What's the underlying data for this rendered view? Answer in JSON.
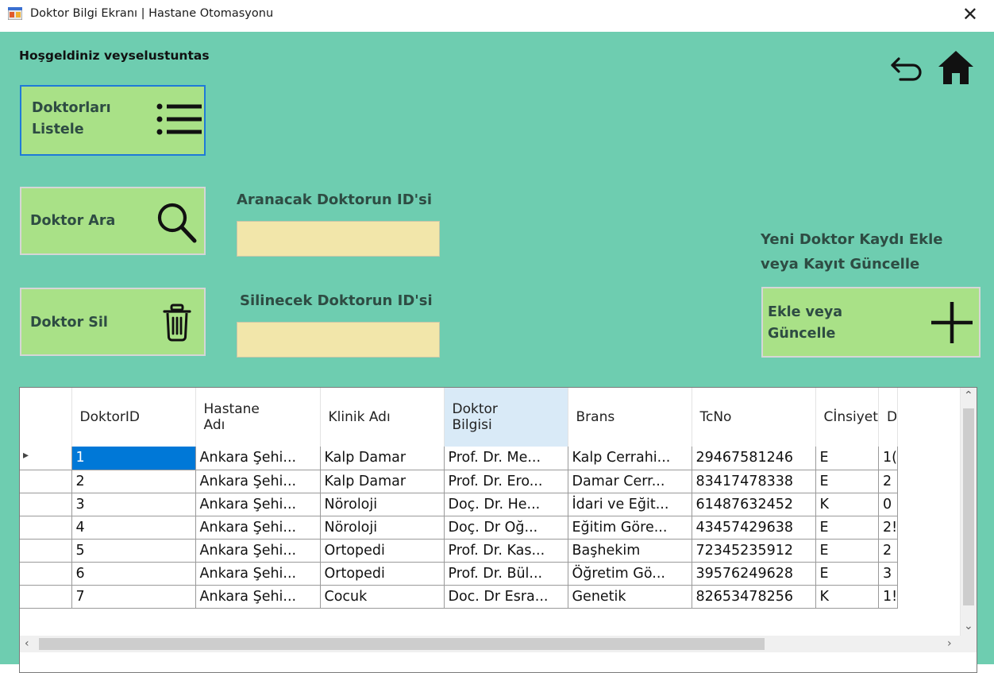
{
  "window": {
    "title": "Doktor Bilgi Ekranı | Hastane Otomasyonu"
  },
  "header": {
    "welcome": "Hoşgeldiniz veyselustuntas"
  },
  "buttons": {
    "list_line1": "Doktorları",
    "list_line2": "Listele",
    "search": "Doktor Ara",
    "delete": "Doktor Sil",
    "add_line1": "Ekle veya",
    "add_line2": "Güncelle"
  },
  "search_field": {
    "label": "Aranacak Doktorun ID'si",
    "value": ""
  },
  "delete_field": {
    "label": "Silinecek Doktorun ID'si",
    "value": ""
  },
  "add_section": {
    "line1": "Yeni Doktor Kaydı Ekle",
    "line2": "veya Kayıt Güncelle"
  },
  "table": {
    "headers": [
      {
        "l1": "DoktorID",
        "l2": ""
      },
      {
        "l1": "Hastane",
        "l2": "Adı"
      },
      {
        "l1": "Klinik Adı",
        "l2": ""
      },
      {
        "l1": "Doktor",
        "l2": "Bilgisi"
      },
      {
        "l1": "Brans",
        "l2": ""
      },
      {
        "l1": "TcNo",
        "l2": ""
      },
      {
        "l1": "Cİnsiyet",
        "l2": ""
      },
      {
        "l1": "D",
        "l2": ""
      }
    ],
    "rows": [
      [
        "1",
        "Ankara Şehi...",
        "Kalp Damar",
        "Prof. Dr. Me...",
        "Kalp Cerrahi...",
        "29467581246",
        "E",
        "1("
      ],
      [
        "2",
        "Ankara Şehi...",
        "Kalp Damar",
        "Prof. Dr. Ero...",
        "Damar Cerr...",
        "83417478338",
        "E",
        "2"
      ],
      [
        "3",
        "Ankara Şehi...",
        "Nöroloji",
        "Doç. Dr. He...",
        "İdari ve Eğit...",
        "61487632452",
        "K",
        "0"
      ],
      [
        "4",
        "Ankara Şehi...",
        "Nöroloji",
        "Doç. Dr Oğ...",
        "Eğitim Göre...",
        "43457429638",
        "E",
        "2!"
      ],
      [
        "5",
        "Ankara Şehi...",
        "Ortopedi",
        "Prof. Dr. Kas...",
        "Başhekim",
        "72345235912",
        "E",
        "2"
      ],
      [
        "6",
        "Ankara Şehi...",
        "Ortopedi",
        "Prof. Dr. Bül...",
        "Öğretim Gö...",
        "39576249628",
        "E",
        "3"
      ],
      [
        "7",
        "Ankara Şehi...",
        "Cocuk",
        "Doc. Dr Esra...",
        "Genetik",
        "82653478256",
        "K",
        "1!"
      ]
    ]
  },
  "colors": {
    "background": "#6ecdb0",
    "button": "#a9e187",
    "textbox": "#f2e6aa",
    "selection": "#0078d7"
  },
  "icons": [
    "app-icon",
    "close-icon",
    "back-arrow-icon",
    "home-icon",
    "list-icon",
    "search-icon",
    "trash-icon",
    "plus-icon"
  ]
}
